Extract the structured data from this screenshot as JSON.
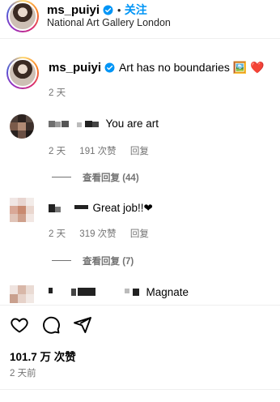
{
  "header": {
    "username": "ms_puiyi",
    "separator": "•",
    "follow_label": "关注",
    "location": "National Art Gallery London"
  },
  "caption": {
    "username": "ms_puiyi",
    "text": "Art has no boundaries 🖼️ ❤️",
    "time": "2 天"
  },
  "comments": [
    {
      "text": "You are art",
      "time": "2 天",
      "likes": "191 次赞",
      "reply_label": "回复",
      "view_replies": "查看回复 (44)"
    },
    {
      "text": "Great job!!❤",
      "time": "2 天",
      "likes": "319 次赞",
      "reply_label": "回复",
      "view_replies": "查看回复 (7)"
    },
    {
      "text": "Magnate"
    }
  ],
  "footer": {
    "likes_count": "101.7 万 次赞",
    "posted_ago": "2 天前"
  },
  "icons": [
    "heart-icon",
    "comment-icon",
    "share-icon",
    "verified-badge-icon"
  ],
  "colors": {
    "link_blue": "#0095f6",
    "verified_blue": "#0095f6",
    "muted": "#737373"
  }
}
